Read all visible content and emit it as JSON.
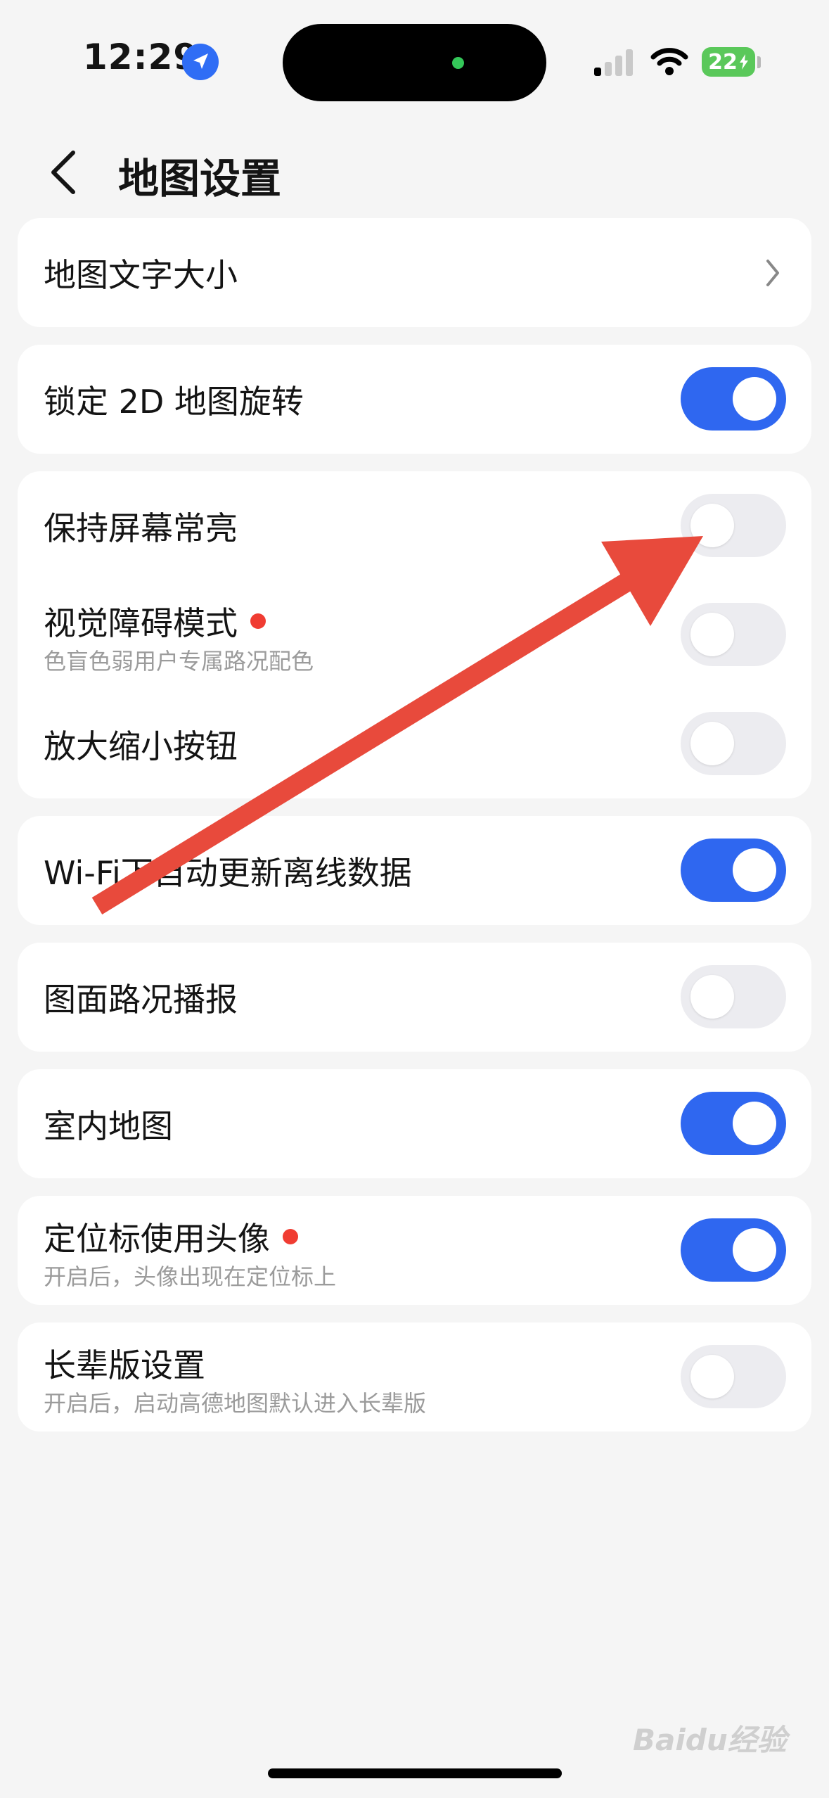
{
  "status_bar": {
    "time": "12:29",
    "battery": "22",
    "icons": [
      "location-arrow-icon",
      "cellular-signal-icon",
      "wifi-icon",
      "battery-charging-icon"
    ]
  },
  "header": {
    "title": "地图设置",
    "back_icon": "chevron-left-icon"
  },
  "settings": {
    "font_size": {
      "label": "地图文字大小",
      "icon": "chevron-right-icon"
    },
    "lock_2d": {
      "label": "锁定 2D 地图旋转",
      "enabled": true
    },
    "keep_screen_on": {
      "label": "保持屏幕常亮",
      "enabled": false
    },
    "visual_impairment": {
      "label": "视觉障碍模式",
      "subtitle": "色盲色弱用户专属路况配色",
      "badge": "red-dot",
      "enabled": false
    },
    "zoom_buttons": {
      "label": "放大缩小按钮",
      "enabled": false
    },
    "wifi_offline": {
      "label": "Wi-Fi下自动更新离线数据",
      "enabled": true
    },
    "traffic_broadcast": {
      "label": "图面路况播报",
      "enabled": false
    },
    "indoor_map": {
      "label": "室内地图",
      "enabled": true
    },
    "avatar_marker": {
      "label": "定位标使用头像",
      "subtitle": "开启后，头像出现在定位标上",
      "badge": "red-dot",
      "enabled": true
    },
    "elder_mode": {
      "label": "长辈版设置",
      "subtitle": "开启后，启动高德地图默认进入长辈版",
      "enabled": false
    }
  },
  "colors": {
    "toggle_on": "#2f67f0",
    "toggle_off": "#ececf0",
    "badge": "#f03c32",
    "annotation_arrow": "#e84a3c",
    "background": "#f5f5f5"
  },
  "watermark": "Baidu经验"
}
